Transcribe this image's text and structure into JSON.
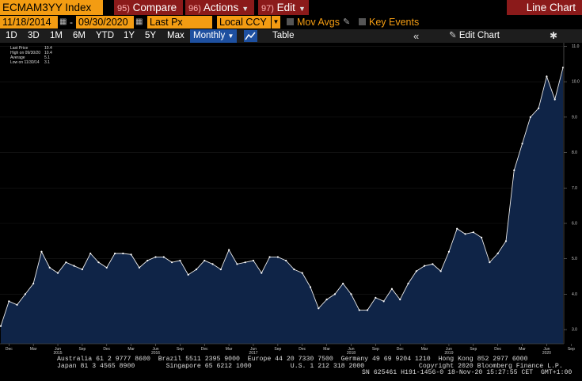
{
  "header": {
    "ticker": "ECMAM3YY Index",
    "compare_num": "95)",
    "compare_label": "Compare",
    "actions_num": "96)",
    "actions_label": "Actions",
    "edit_num": "97)",
    "edit_label": "Edit",
    "chart_type": "Line Chart"
  },
  "controls": {
    "start_date": "11/18/2014",
    "end_date": "09/30/2020",
    "field": "Last Px",
    "currency": "Local CCY",
    "mov_avgs": "Mov Avgs",
    "key_events": "Key Events"
  },
  "toolbar": {
    "periods": [
      "1D",
      "3D",
      "1M",
      "6M",
      "YTD",
      "1Y",
      "5Y",
      "Max"
    ],
    "frequency": "Monthly",
    "table": "Table",
    "edit_chart": "Edit Chart"
  },
  "legend": {
    "last_price": "Last Price",
    "last_price_val": "10.4",
    "high": "High on 09/30/20",
    "high_val": "10.4",
    "average": "Average",
    "average_val": "5.1",
    "low": "Low on 11/30/14",
    "low_val": "3.1"
  },
  "chart_data": {
    "type": "area",
    "frequency": "monthly",
    "colors": {
      "line": "#e8e8e8",
      "fill": "#0f2447",
      "background": "#000000"
    },
    "y_axis": {
      "ticks": [
        "3.0",
        "4.0",
        "5.0",
        "6.0",
        "7.0",
        "8.0",
        "9.0",
        "10.0",
        "11.0"
      ],
      "range": [
        2.6,
        11.1
      ],
      "position": "right"
    },
    "x_axis": {
      "month_ticks": [
        "Dec",
        "Mar",
        "Jun",
        "Sep",
        "Dec",
        "Mar",
        "Jun",
        "Sep",
        "Dec",
        "Mar",
        "Jun",
        "Sep",
        "Dec",
        "Mar",
        "Jun",
        "Sep",
        "Dec",
        "Mar",
        "Jun",
        "Sep",
        "Dec",
        "Mar",
        "Jun",
        "Sep"
      ],
      "year_labels": [
        "2015",
        "2016",
        "2017",
        "2018",
        "2019",
        "2020"
      ]
    },
    "series": [
      {
        "values": [
          3.1,
          3.8,
          3.7,
          4.0,
          4.3,
          5.2,
          4.75,
          4.6,
          4.9,
          4.8,
          4.7,
          5.15,
          4.9,
          4.75,
          5.15,
          5.15,
          5.12,
          4.75,
          4.95,
          5.05,
          5.05,
          4.9,
          4.95,
          4.55,
          4.7,
          4.95,
          4.85,
          4.7,
          5.25,
          4.85,
          4.9,
          4.95,
          4.6,
          5.05,
          5.05,
          4.95,
          4.7,
          4.6,
          4.2,
          3.6,
          3.85,
          4.0,
          4.3,
          4.0,
          3.55,
          3.55,
          3.9,
          3.8,
          4.15,
          3.85,
          4.3,
          4.65,
          4.8,
          4.85,
          4.65,
          5.2,
          5.85,
          5.7,
          5.75,
          5.6,
          4.9,
          5.15,
          5.5,
          7.5,
          8.25,
          9.0,
          9.25,
          10.15,
          9.5,
          10.4
        ]
      }
    ]
  },
  "footer": {
    "line1": "Australia 61 2 9777 8600  Brazil 5511 2395 9000  Europe 44 20 7330 7500  Germany 49 69 9204 1210  Hong Kong 852 2977 6000",
    "line2": "Japan 81 3 4565 8900        Singapore 65 6212 1000          U.S. 1 212 318 2000              Copyright 2020 Bloomberg Finance L.P.",
    "line3": "SN 625461 H191-1456-0 18-Nov-20 15:27:55 CET  GMT+1:00"
  }
}
